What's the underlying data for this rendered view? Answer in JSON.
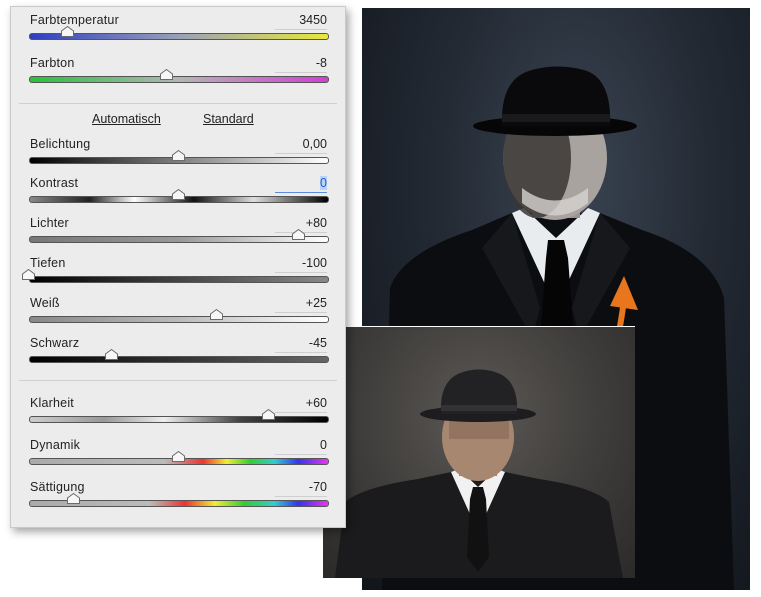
{
  "panel": {
    "auto_label": "Automatisch",
    "default_label": "Standard",
    "sliders": [
      {
        "label": "Farbtemperatur",
        "value": "3450",
        "level": 0.13,
        "track": "temp"
      },
      {
        "label": "Farbton",
        "value": "-8",
        "level": 0.46,
        "track": "tint"
      },
      {
        "label": "Belichtung",
        "value": "0,00",
        "level": 0.5,
        "track": "bw"
      },
      {
        "label": "Kontrast",
        "value": "0",
        "level": 0.5,
        "track": "contrast",
        "active": true
      },
      {
        "label": "Lichter",
        "value": "+80",
        "level": 0.9,
        "track": "light"
      },
      {
        "label": "Tiefen",
        "value": "-100",
        "level": 0.0,
        "track": "dark"
      },
      {
        "label": "Weiß",
        "value": "+25",
        "level": 0.625,
        "track": "grey"
      },
      {
        "label": "Schwarz",
        "value": "-45",
        "level": 0.275,
        "track": "dark2"
      },
      {
        "label": "Klarheit",
        "value": "+60",
        "level": 0.8,
        "track": "clarity"
      },
      {
        "label": "Dynamik",
        "value": "0",
        "level": 0.5,
        "track": "vib"
      },
      {
        "label": "Sättigung",
        "value": "-70",
        "level": 0.15,
        "track": "sat"
      }
    ]
  },
  "colors": {
    "accent": "#1d5fd6",
    "arrow": "#e8761c"
  }
}
